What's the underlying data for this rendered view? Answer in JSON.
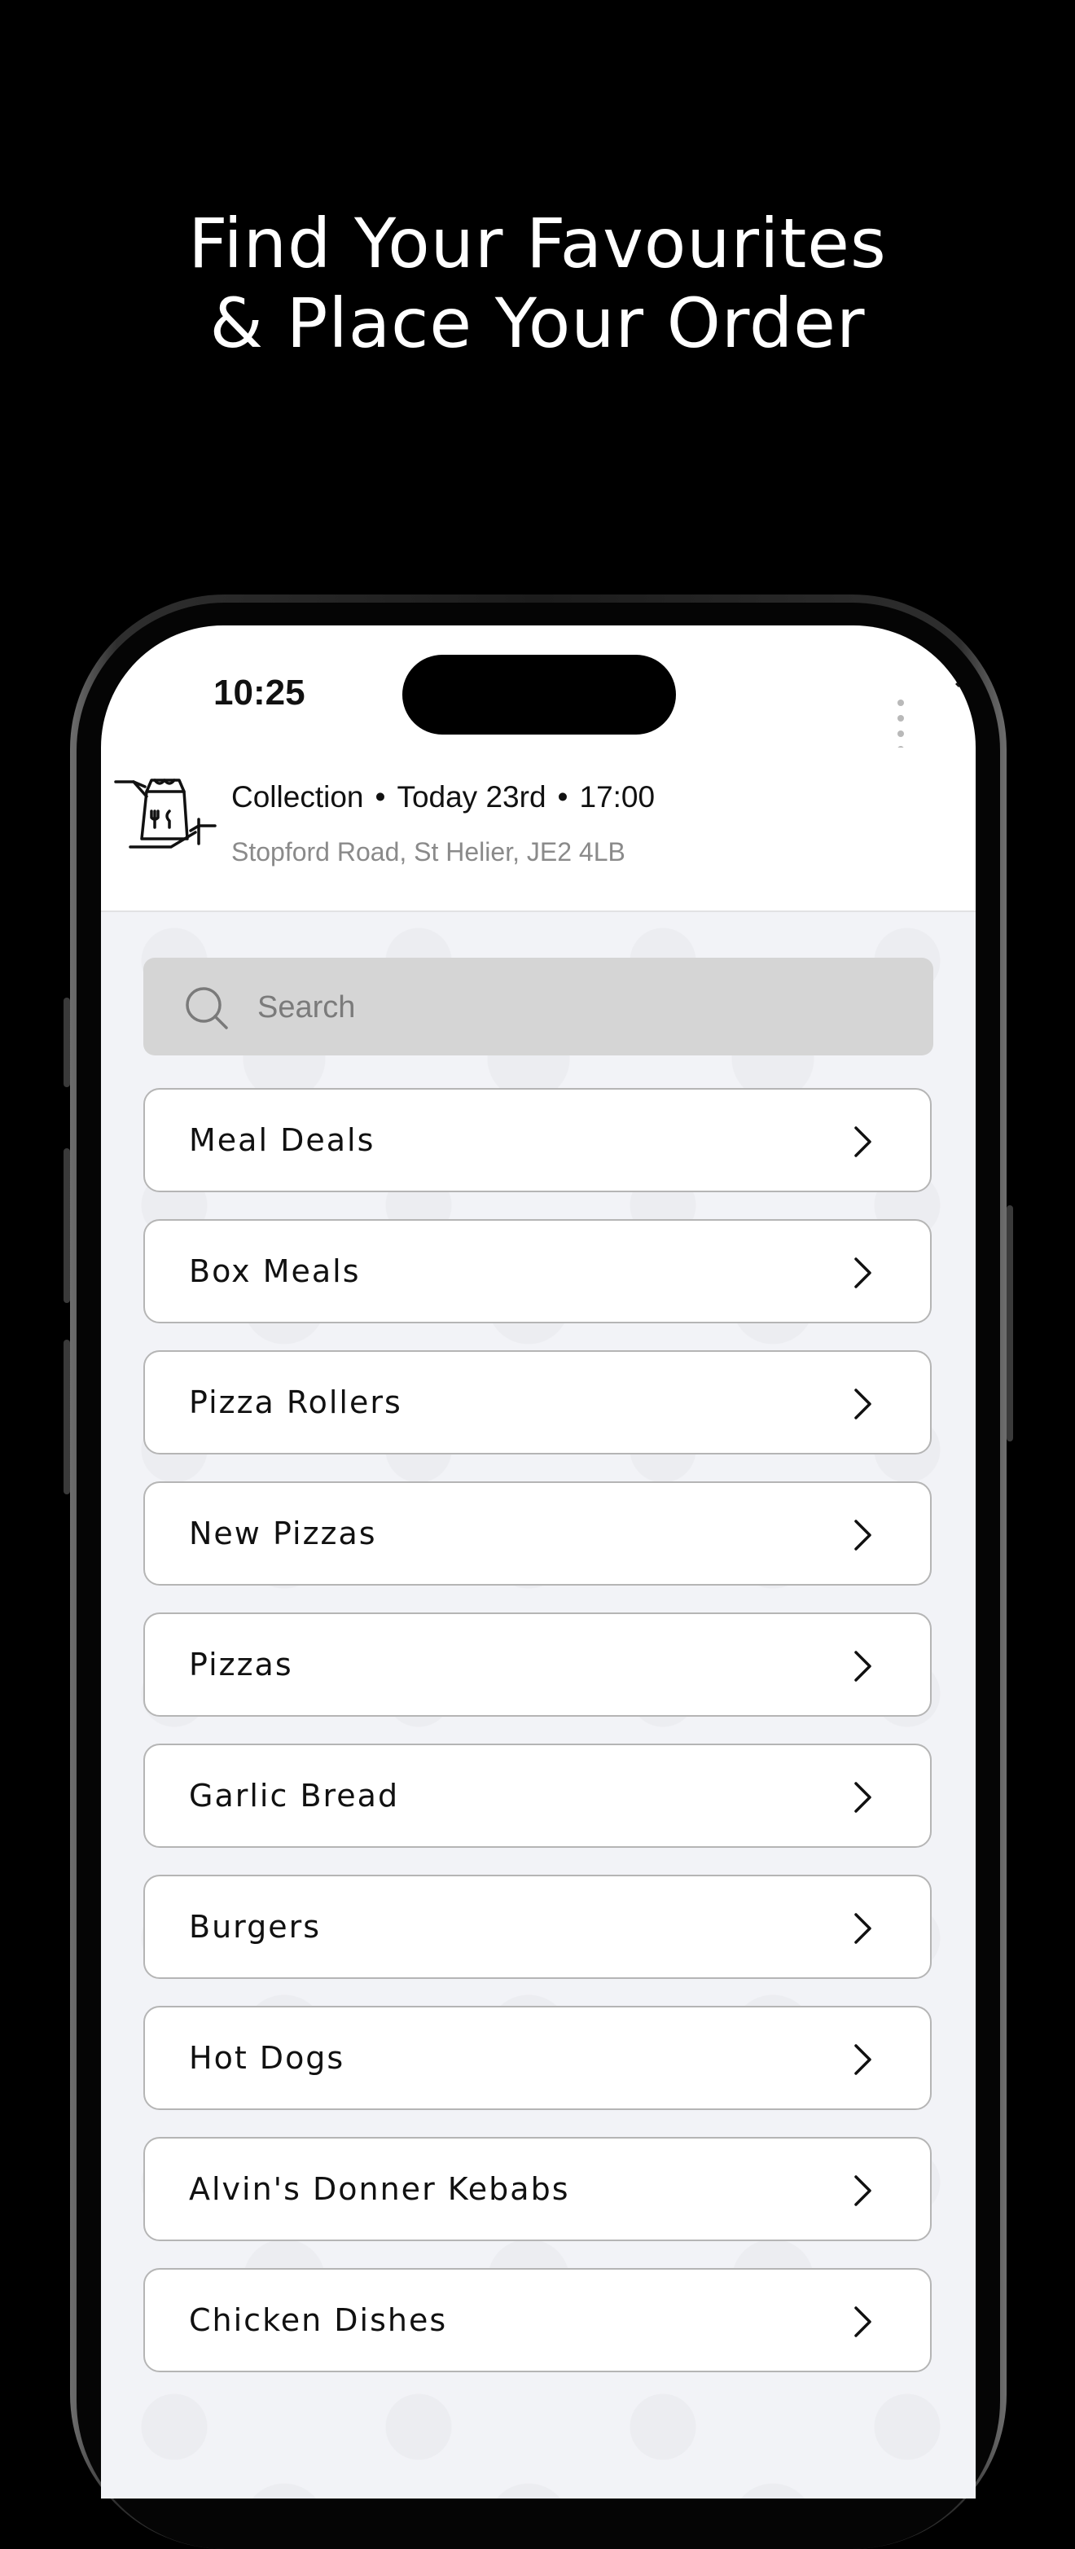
{
  "headline": {
    "line1": "Find Your Favourites",
    "line2": "& Place Your Order"
  },
  "status_bar": {
    "time": "10:25"
  },
  "order_header": {
    "mode": "Collection",
    "date": "Today 23rd",
    "time": "17:00",
    "separator": "•",
    "address": "Stopford Road, St Helier, JE2  4LB"
  },
  "search": {
    "placeholder": "Search"
  },
  "menu": {
    "categories": [
      {
        "label": "Meal Deals"
      },
      {
        "label": "Box Meals"
      },
      {
        "label": "Pizza Rollers"
      },
      {
        "label": "New Pizzas"
      },
      {
        "label": "Pizzas"
      },
      {
        "label": "Garlic Bread"
      },
      {
        "label": "Burgers"
      },
      {
        "label": "Hot Dogs"
      },
      {
        "label": "Alvin's Donner Kebabs"
      },
      {
        "label": "Chicken Dishes"
      }
    ]
  },
  "colors": {
    "background": "#000000",
    "content_bg": "#f2f3f7",
    "search_bg": "#d5d5d5",
    "card_border": "#b5b5b5",
    "muted_text": "#8a8a8a"
  }
}
